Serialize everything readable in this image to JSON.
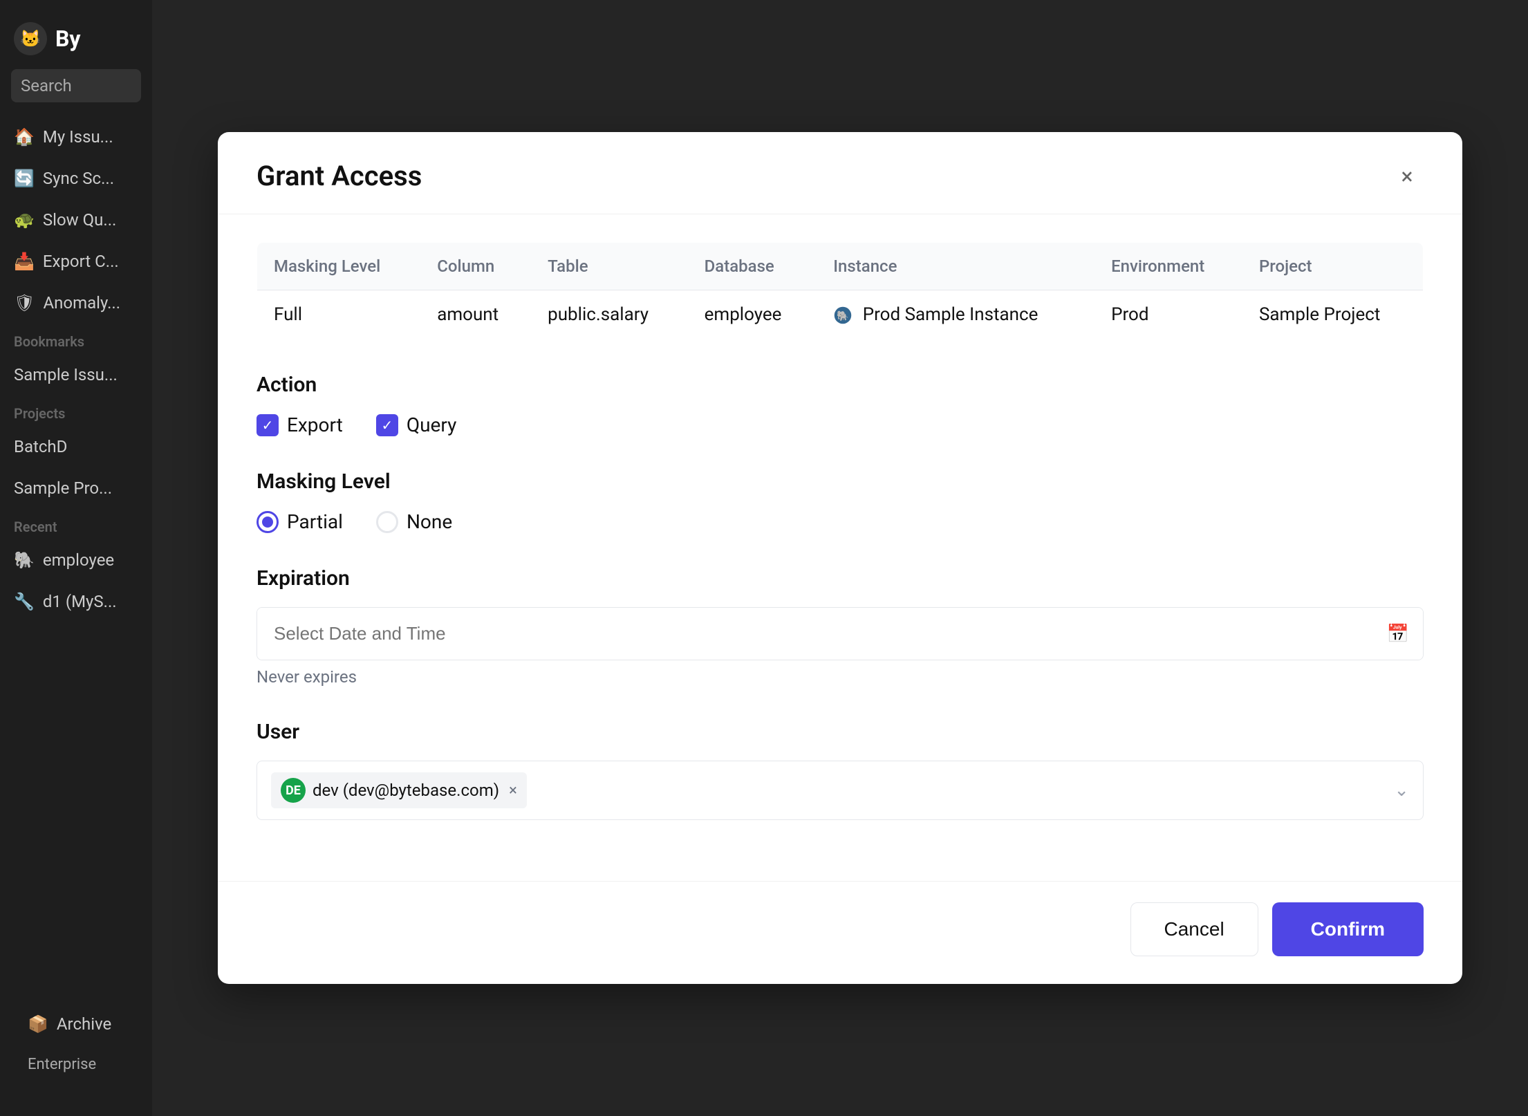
{
  "app": {
    "name": "By"
  },
  "sidebar": {
    "search_placeholder": "Search",
    "items": [
      {
        "id": "my-issues",
        "label": "My Issu..."
      },
      {
        "id": "sync-sc",
        "label": "Sync Sc..."
      },
      {
        "id": "slow-qu",
        "label": "Slow Qu..."
      },
      {
        "id": "export-c",
        "label": "Export C..."
      },
      {
        "id": "anomaly",
        "label": "Anomaly..."
      }
    ],
    "sections": [
      {
        "label": "Bookmarks",
        "items": [
          {
            "id": "sample-issue",
            "label": "Sample Issu..."
          }
        ]
      },
      {
        "label": "Projects",
        "items": [
          {
            "id": "batchd",
            "label": "BatchD"
          },
          {
            "id": "sample-pro",
            "label": "Sample Pro..."
          }
        ]
      },
      {
        "label": "Recent",
        "items": [
          {
            "id": "employee",
            "label": "employee"
          },
          {
            "id": "d1-mysql",
            "label": "d1 (MyS..."
          }
        ]
      }
    ],
    "footer": {
      "archive_label": "Archive",
      "enterprise_label": "Enterprise"
    }
  },
  "modal": {
    "title": "Grant Access",
    "close_label": "×",
    "table": {
      "headers": [
        "Masking Level",
        "Column",
        "Table",
        "Database",
        "Instance",
        "Environment",
        "Project"
      ],
      "row": {
        "masking_level": "Full",
        "column": "amount",
        "table": "public.salary",
        "database": "employee",
        "instance": "Prod Sample Instance",
        "environment": "Prod",
        "project": "Sample Project"
      }
    },
    "action": {
      "label": "Action",
      "export_label": "Export",
      "export_checked": true,
      "query_label": "Query",
      "query_checked": true
    },
    "masking_level": {
      "label": "Masking Level",
      "partial_label": "Partial",
      "none_label": "None",
      "selected": "Partial"
    },
    "expiration": {
      "label": "Expiration",
      "placeholder": "Select Date and Time",
      "never_expires_text": "Never expires"
    },
    "user": {
      "label": "User",
      "tag": {
        "initials": "DE",
        "name": "dev",
        "email": "(dev@bytebase.com)"
      }
    },
    "footer": {
      "cancel_label": "Cancel",
      "confirm_label": "Confirm"
    }
  }
}
